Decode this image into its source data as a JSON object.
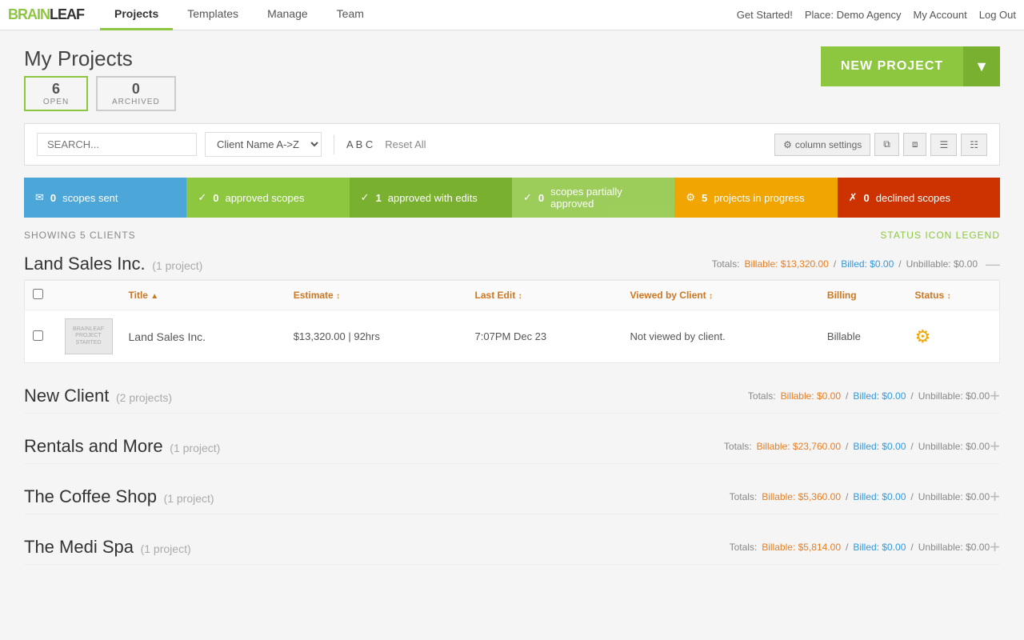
{
  "nav": {
    "logo": "BRAIN LEAF",
    "links": [
      {
        "label": "Projects",
        "active": true
      },
      {
        "label": "Templates",
        "active": false
      },
      {
        "label": "Manage",
        "active": false
      },
      {
        "label": "Team",
        "active": false
      }
    ],
    "right": [
      {
        "label": "Get Started!"
      },
      {
        "label": "Place: Demo Agency"
      },
      {
        "label": "My Account"
      },
      {
        "label": "Log Out"
      }
    ]
  },
  "page": {
    "title": "My Projects",
    "open_count": "6",
    "open_label": "OPEN",
    "archived_count": "0",
    "archived_label": "ARCHIVED"
  },
  "new_project": {
    "label": "NEW PROJECT"
  },
  "toolbar": {
    "search_placeholder": "SEARCH...",
    "sort_value": "Client Name A->Z",
    "abc_label": "A B C",
    "reset_label": "Reset All",
    "column_settings_label": "column settings"
  },
  "status_bars": [
    {
      "type": "sent",
      "count": "0",
      "label": "scopes sent"
    },
    {
      "type": "approved",
      "count": "0",
      "label": "approved scopes"
    },
    {
      "type": "approved-edits",
      "count": "1",
      "label": "approved with edits"
    },
    {
      "type": "partial",
      "count": "0",
      "label": "scopes partially approved"
    },
    {
      "type": "progress",
      "count": "5",
      "label": "projects in progress"
    },
    {
      "type": "declined",
      "count": "0",
      "label": "declined scopes"
    }
  ],
  "showing": {
    "text": "SHOWING 5 CLIENTS",
    "legend": "STATUS ICON LEGEND"
  },
  "clients": [
    {
      "name": "Land Sales Inc.",
      "project_count": "(1 project)",
      "totals": "Totals: Billable: $13,320.00 / Billed: $0.00 / Unbillable: $0.00",
      "expanded": true,
      "projects": [
        {
          "title": "Land Sales Inc.",
          "estimate": "$13,320.00 | 92hrs",
          "last_edit": "7:07PM Dec 23",
          "viewed_by_client": "Not viewed by client.",
          "billing": "Billable",
          "status": "gear"
        }
      ]
    },
    {
      "name": "New Client",
      "project_count": "(2 projects)",
      "totals": "Totals: Billable: $0.00 / Billed: $0.00 / Unbillable: $0.00",
      "expanded": false
    },
    {
      "name": "Rentals and More",
      "project_count": "(1 project)",
      "totals": "Totals: Billable: $23,760.00 / Billed: $0.00 / Unbillable: $0.00",
      "expanded": false
    },
    {
      "name": "The Coffee Shop",
      "project_count": "(1 project)",
      "totals": "Totals: Billable: $5,360.00 / Billed: $0.00 / Unbillable: $0.00",
      "expanded": false
    },
    {
      "name": "The Medi Spa",
      "project_count": "(1 project)",
      "totals": "Totals: Billable: $5,814.00 / Billed: $0.00 / Unbillable: $0.00",
      "expanded": false
    }
  ],
  "table_headers": {
    "title": "Title",
    "estimate": "Estimate",
    "last_edit": "Last Edit",
    "viewed_by_client": "Viewed by Client",
    "billing": "Billing",
    "status": "Status"
  },
  "thumb_text": "BRAINLEAF PROJECT STARTED"
}
